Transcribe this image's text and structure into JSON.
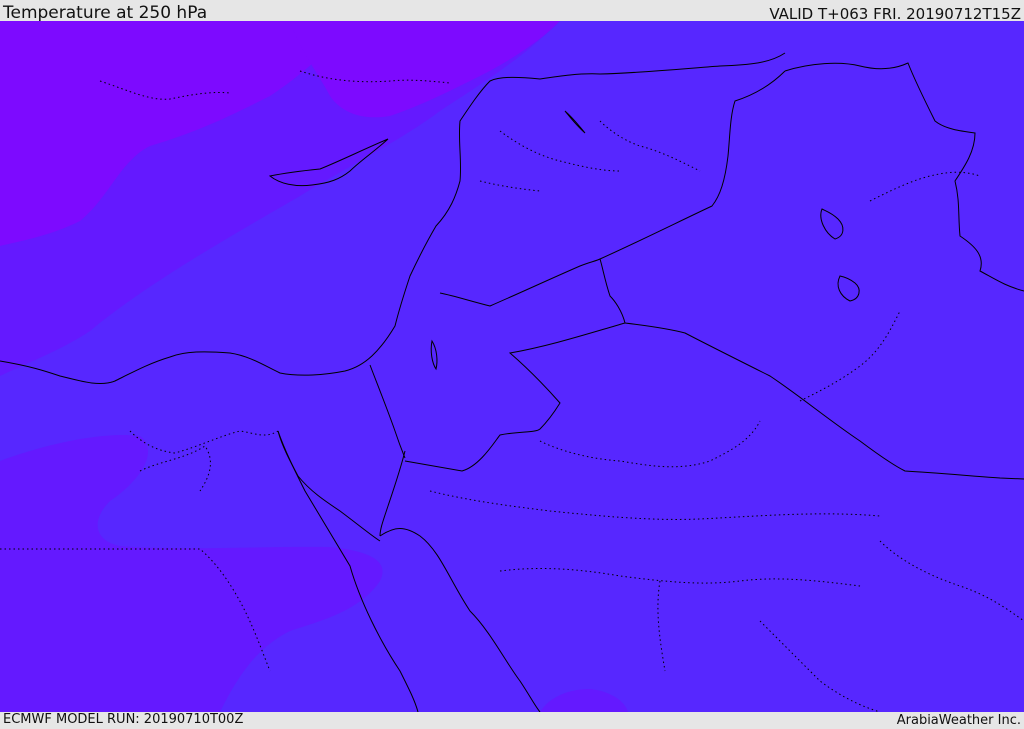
{
  "header": {
    "title": "Temperature at 250 hPa",
    "valid": "VALID T+063 FRI. 20190712T15Z"
  },
  "footer": {
    "model_run": "ECMWF MODEL RUN: 20190710T00Z",
    "credit": "ArabiaWeather Inc."
  },
  "map": {
    "variable": "Temperature",
    "level": "250 hPa",
    "colors": {
      "base": "#5727ff",
      "band_mid": "#6419ff",
      "band_cold": "#7d0aff",
      "boundary": "#000000"
    }
  }
}
